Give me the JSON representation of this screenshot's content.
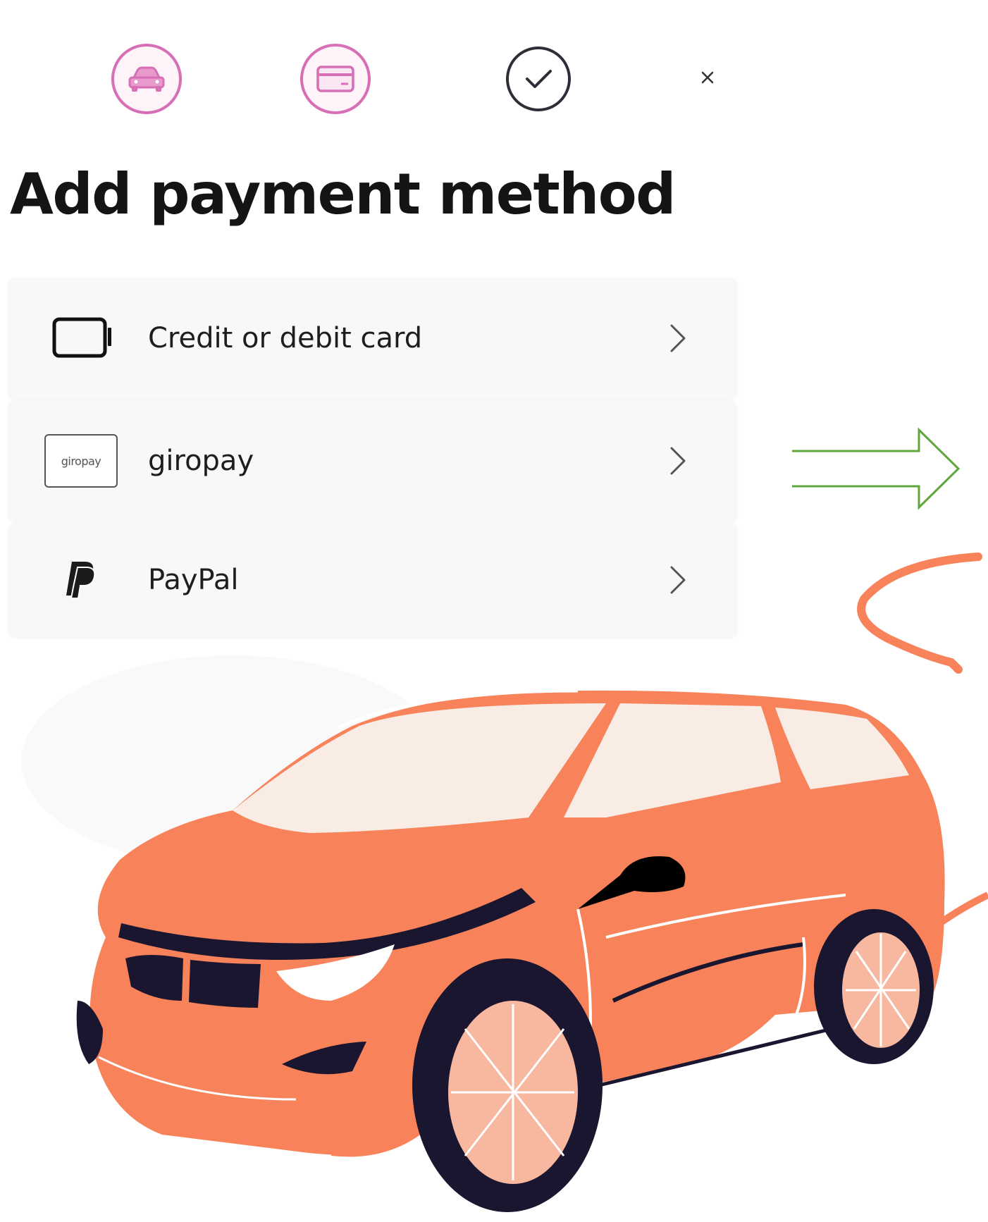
{
  "header": {
    "steps": [
      {
        "icon": "car-icon",
        "state": "active"
      },
      {
        "icon": "credit-card-icon",
        "state": "active"
      },
      {
        "icon": "check-circle-icon",
        "state": "done"
      }
    ],
    "close_icon": "close-icon"
  },
  "page": {
    "title": "Add payment method"
  },
  "payment_methods": [
    {
      "label": "Credit or debit card",
      "icon": "card-outline-icon"
    },
    {
      "label": "giropay",
      "icon": "giropay-logo",
      "logo_text": "giropay"
    },
    {
      "label": "PayPal",
      "icon": "paypal-logo-icon"
    }
  ],
  "colors": {
    "accent_pink": "#d76fb6",
    "car_orange": "#f8825a",
    "arrow_green": "#5fa63c",
    "dark_navy": "#1a1630",
    "row_background": "#f8f8f9"
  }
}
